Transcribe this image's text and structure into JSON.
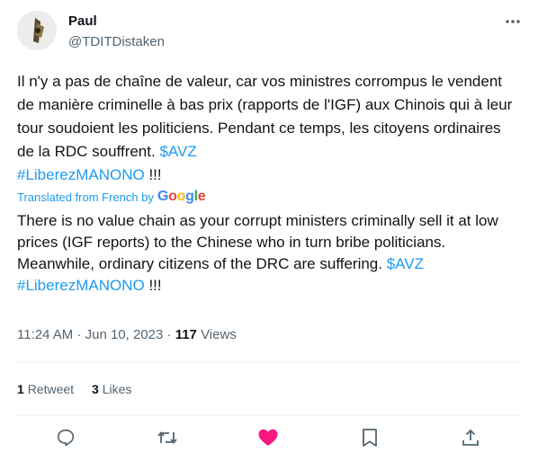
{
  "author": {
    "name": "Paul",
    "handle": "@TDITDistaken"
  },
  "tweet": {
    "text_main": "Il n'y a pas de chaîne de valeur, car vos ministres corrompus le vendent de manière criminelle à bas prix (rapports de l'IGF) aux Chinois qui à leur tour soudoient les politiciens. Pendant ce temps, les citoyens ordinaires de la RDC souffrent.",
    "cashtag": "$AVZ",
    "hashtag": "#LiberezMANONO",
    "suffix": " !!!"
  },
  "translation": {
    "label": "Translated from French by",
    "provider": "Google",
    "text_main": "There is no value chain as your corrupt ministers criminally sell it at low prices (IGF reports) to the Chinese who in turn bribe politicians. Meanwhile, ordinary citizens of the DRC are suffering.",
    "cashtag": "$AVZ",
    "hashtag": "#LiberezMANONO",
    "suffix": " !!!"
  },
  "meta": {
    "time": "11:24 AM",
    "separator": " · ",
    "date": "Jun 10, 2023",
    "views_count": "117",
    "views_label": "Views"
  },
  "stats": {
    "retweets_count": "1",
    "retweets_label": "Retweet",
    "likes_count": "3",
    "likes_label": "Likes"
  },
  "colors": {
    "link": "#1d9bf0",
    "like_pink": "#f91880",
    "muted": "#536471"
  },
  "icons": [
    "more-icon",
    "reply-icon",
    "retweet-icon",
    "like-icon",
    "bookmark-icon",
    "share-icon"
  ]
}
